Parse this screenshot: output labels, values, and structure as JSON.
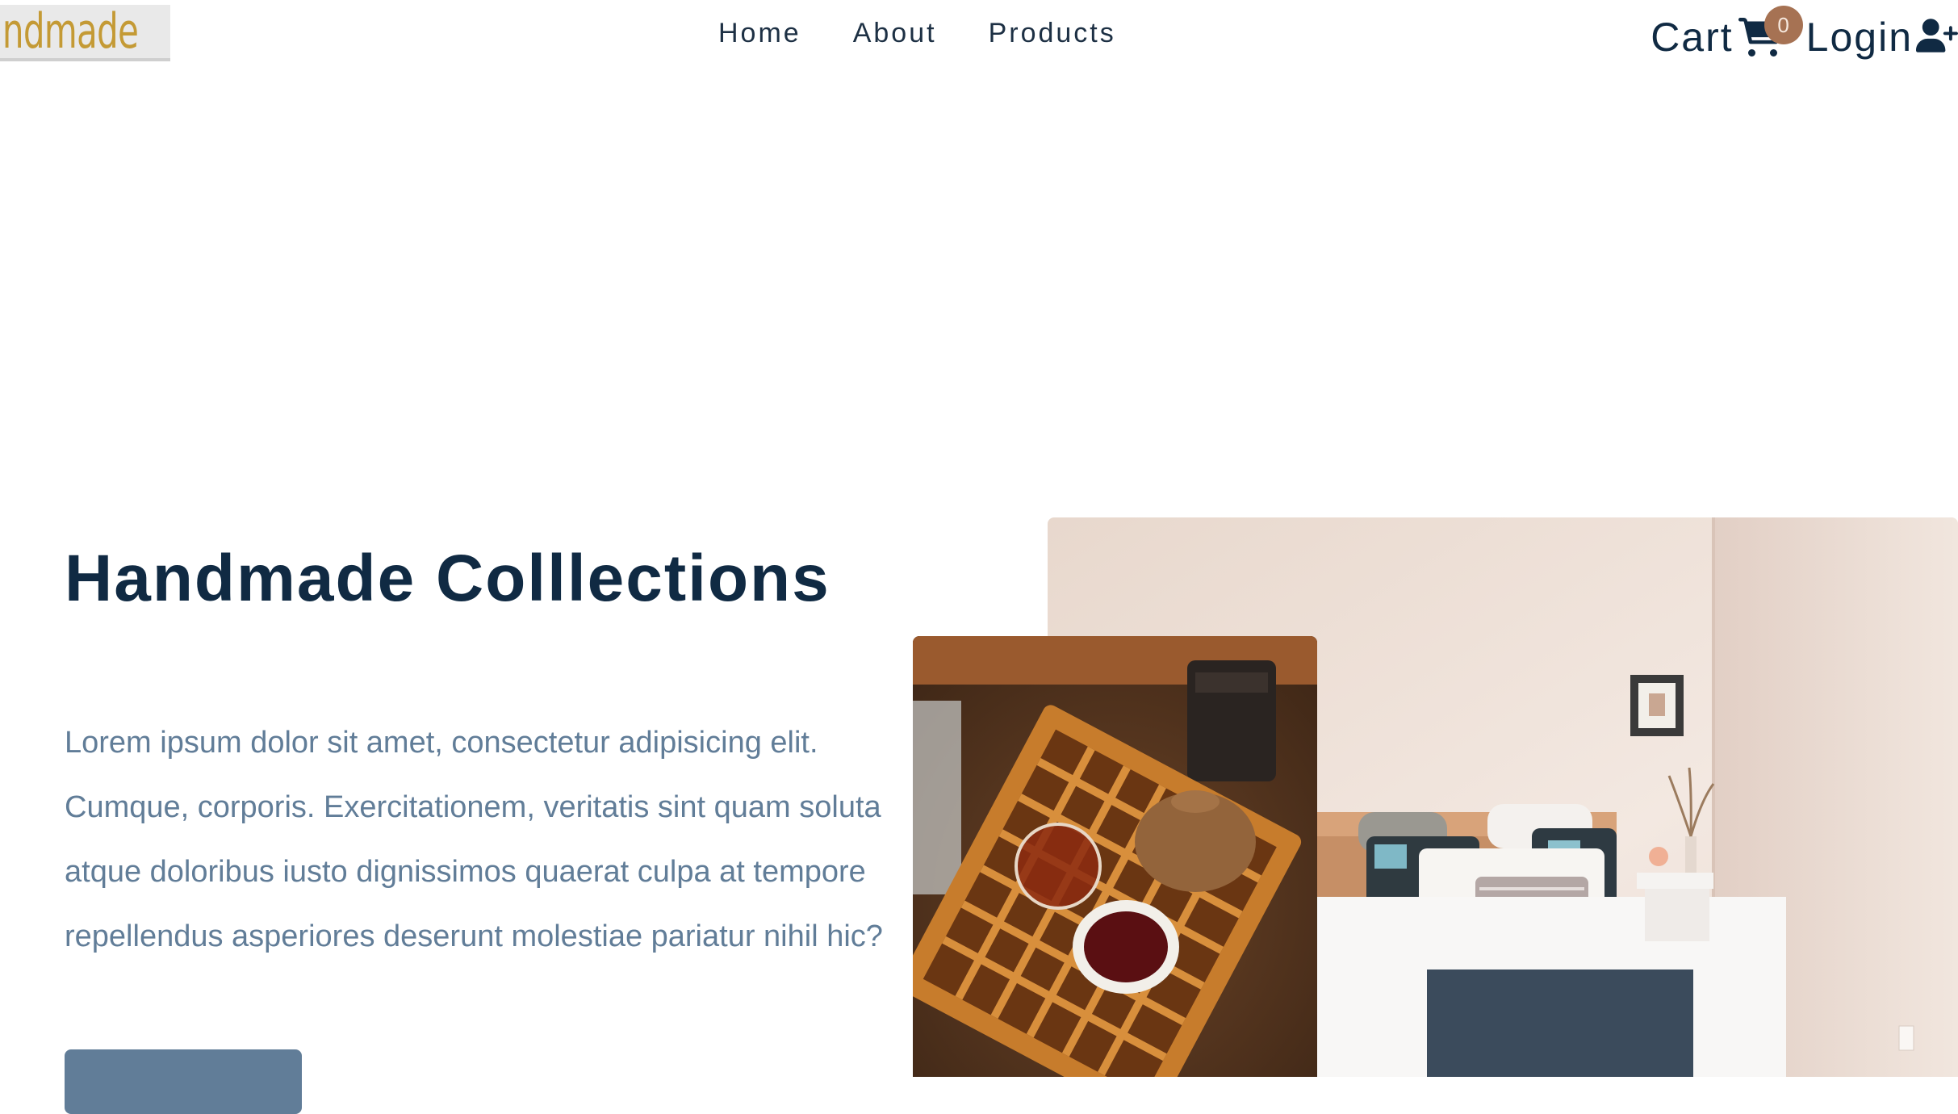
{
  "header": {
    "logo_text": "Handmade",
    "nav": [
      {
        "label": "Home"
      },
      {
        "label": "About"
      },
      {
        "label": "Products"
      }
    ],
    "cart_label": "Cart",
    "cart_count": "0",
    "login_label": "Login"
  },
  "hero": {
    "title": "Handmade Colllections",
    "description": "Lorem ipsum dolor sit amet, consectetur adipisicing elit. Cumque, corporis. Exercitationem, veritatis sint quam soluta atque doloribus iusto dignissimos quaerat culpa at tempore repellendus asperiores deserunt molestiae pariatur nihil hic?",
    "button_label": ""
  },
  "colors": {
    "primary_dark": "#102a43",
    "text_muted": "#617d98",
    "badge": "#a67253",
    "logo_gold": "#c49a35"
  },
  "icons": {
    "cart": "cart-icon",
    "login": "user-plus-icon"
  }
}
